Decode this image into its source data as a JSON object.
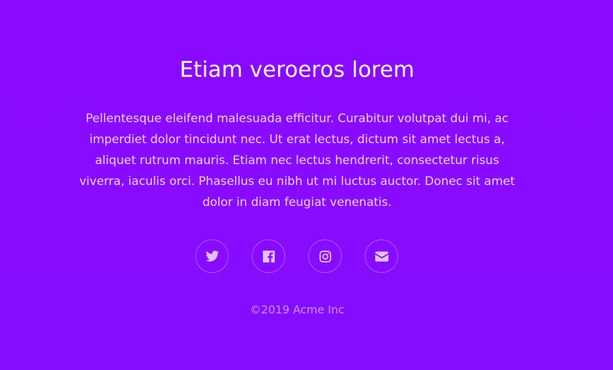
{
  "footer": {
    "title": "Etiam veroeros lorem",
    "body": "Pellentesque eleifend malesuada efficitur. Curabitur volutpat dui mi, ac imperdiet dolor tincidunt nec. Ut erat lectus, dictum sit amet lectus a, aliquet rutrum mauris. Etiam nec lectus hendrerit, consectetur risus viverra, iaculis orci. Phasellus eu nibh ut mi luctus auctor. Donec sit amet dolor in diam feugiat venenatis.",
    "socials": [
      {
        "icon": "twitter-icon"
      },
      {
        "icon": "facebook-icon"
      },
      {
        "icon": "instagram-icon"
      },
      {
        "icon": "envelope-icon"
      }
    ],
    "copyright": "©2019 Acme Inc"
  },
  "colors": {
    "background": "#8a0aff",
    "text": "#ffffff"
  }
}
